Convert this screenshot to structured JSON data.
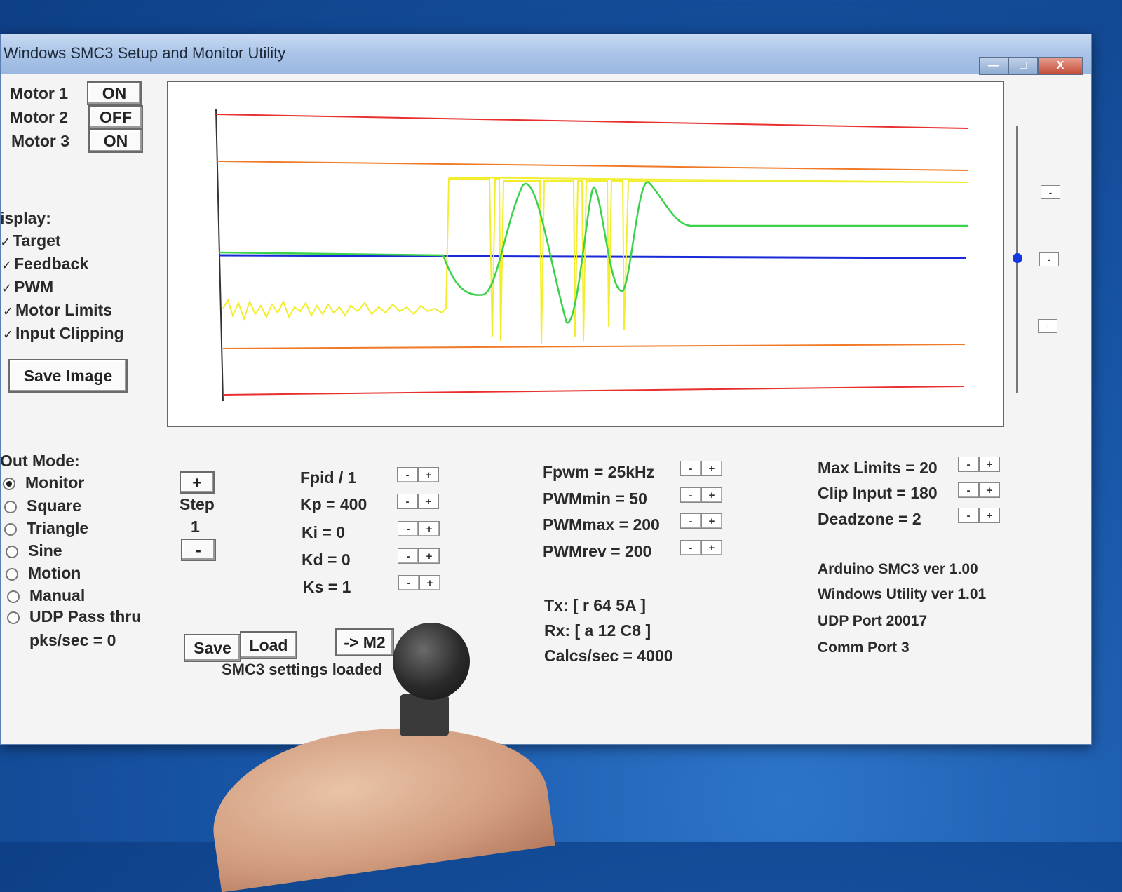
{
  "window": {
    "title": "Windows SMC3 Setup and Monitor Utility",
    "minimize": "—",
    "maximize": "□",
    "close": "X"
  },
  "motors": [
    {
      "label": "Motor 1",
      "state": "ON"
    },
    {
      "label": "Motor 2",
      "state": "OFF"
    },
    {
      "label": "Motor 3",
      "state": "ON"
    }
  ],
  "display": {
    "heading": "isplay:",
    "options": [
      {
        "label": "Target",
        "checked": true
      },
      {
        "label": "Feedback",
        "checked": true
      },
      {
        "label": "PWM",
        "checked": true
      },
      {
        "label": "Motor Limits",
        "checked": true
      },
      {
        "label": "Input Clipping",
        "checked": true
      }
    ],
    "check_glyph": "✓",
    "save_image": "Save Image"
  },
  "out_mode": {
    "heading": "Out Mode:",
    "options": [
      "Monitor",
      "Square",
      "Triangle",
      "Sine",
      "Motion",
      "Manual",
      "UDP Pass thru"
    ],
    "selected": "Monitor",
    "pks": "pks/sec = 0"
  },
  "step": {
    "plus": "+",
    "label": "Step",
    "value": "1",
    "minus": "-"
  },
  "pid": {
    "rows": [
      {
        "label": "Fpid / 1"
      },
      {
        "label": "Kp = 400"
      },
      {
        "label": "Ki = 0"
      },
      {
        "label": "Kd = 0"
      },
      {
        "label": "Ks = 1"
      }
    ]
  },
  "pwm": {
    "rows": [
      {
        "label": "Fpwm = 25kHz"
      },
      {
        "label": "PWMmin = 50"
      },
      {
        "label": "PWMmax = 200"
      },
      {
        "label": "PWMrev = 200"
      }
    ],
    "tx": "Tx: [ r 64 5A ]",
    "rx": "Rx: [ a 12 C8 ]",
    "calcs": "Calcs/sec = 4000"
  },
  "limits": {
    "rows": [
      {
        "label": "Max Limits = 20"
      },
      {
        "label": "Clip Input = 180"
      },
      {
        "label": "Deadzone = 2"
      }
    ]
  },
  "info": {
    "arduino": "Arduino SMC3 ver 1.00",
    "utility": "Windows Utility ver 1.01",
    "udp": "UDP Port 20017",
    "comm": "Comm Port 3"
  },
  "actions": {
    "save": "Save",
    "load": "Load",
    "to_m2": "-> M2",
    "status": "SMC3 settings loaded"
  },
  "mini_buttons": {
    "minus": "-",
    "plus": "+"
  },
  "trace_colors": {
    "target": "#1a2ad8",
    "feedback": "#3bd14a",
    "pwm": "#f2ee2e",
    "motor_limits": "#f07a28",
    "input_clipping": "#e83030"
  }
}
